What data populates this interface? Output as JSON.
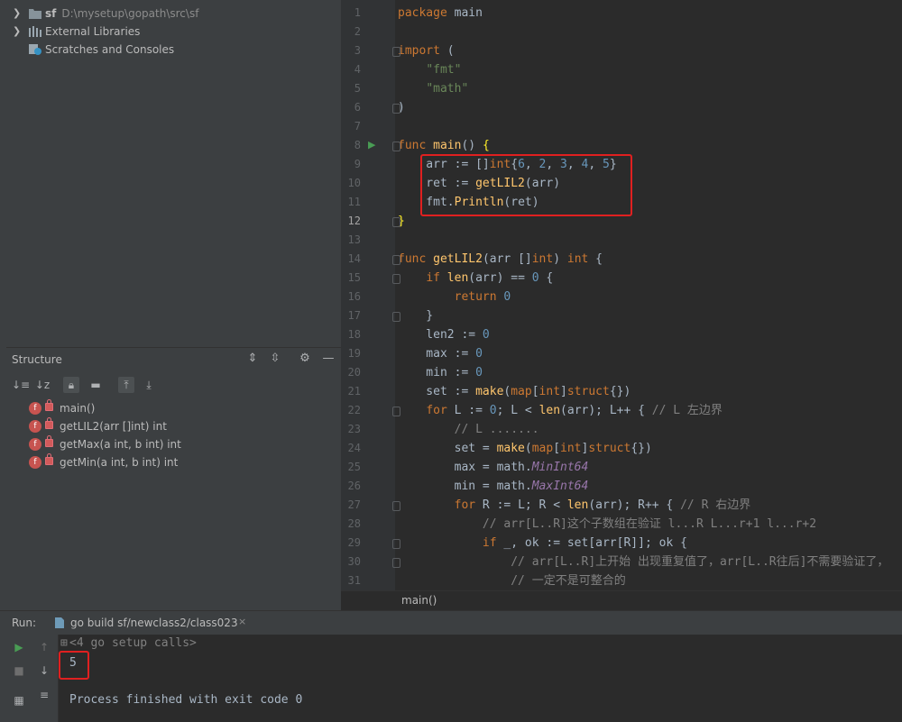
{
  "project": {
    "root": {
      "name": "sf",
      "path": "D:\\mysetup\\gopath\\src\\sf"
    },
    "items": [
      "External Libraries",
      "Scratches and Consoles"
    ]
  },
  "structure": {
    "title": "Structure",
    "members": [
      "main()",
      "getLIL2(arr []int) int",
      "getMax(a int, b int) int",
      "getMin(a int, b int) int"
    ],
    "badge": "f"
  },
  "editor": {
    "line_numbers": [
      "1",
      "2",
      "3",
      "4",
      "5",
      "6",
      "7",
      "8",
      "9",
      "10",
      "11",
      "12",
      "13",
      "14",
      "15",
      "16",
      "17",
      "18",
      "19",
      "20",
      "21",
      "22",
      "23",
      "24",
      "25",
      "26",
      "27",
      "28",
      "29",
      "30",
      "31"
    ],
    "comments": {
      "l21": "// L 左边界",
      "l22": "// L .......",
      "l26": "// R 右边界",
      "l27": "// arr[L..R]这个子数组在验证 l...R L...r+1 l...r+2",
      "l29": "// arr[L..R]上开始 出现重复值了，arr[L..R往后]不需要验证了，",
      "l30": "// 一定不是可整合的"
    },
    "breadcrumb": "main()"
  },
  "run": {
    "label": "Run:",
    "tab": "go build sf/newclass2/class023",
    "close": "×",
    "console": {
      "setup": "<4 go setup calls>",
      "output": "5",
      "finished": "Process finished with exit code 0"
    }
  },
  "colors": {
    "highlight": "#e02020",
    "accent": "#4a88c7",
    "run_green": "#499c54"
  }
}
